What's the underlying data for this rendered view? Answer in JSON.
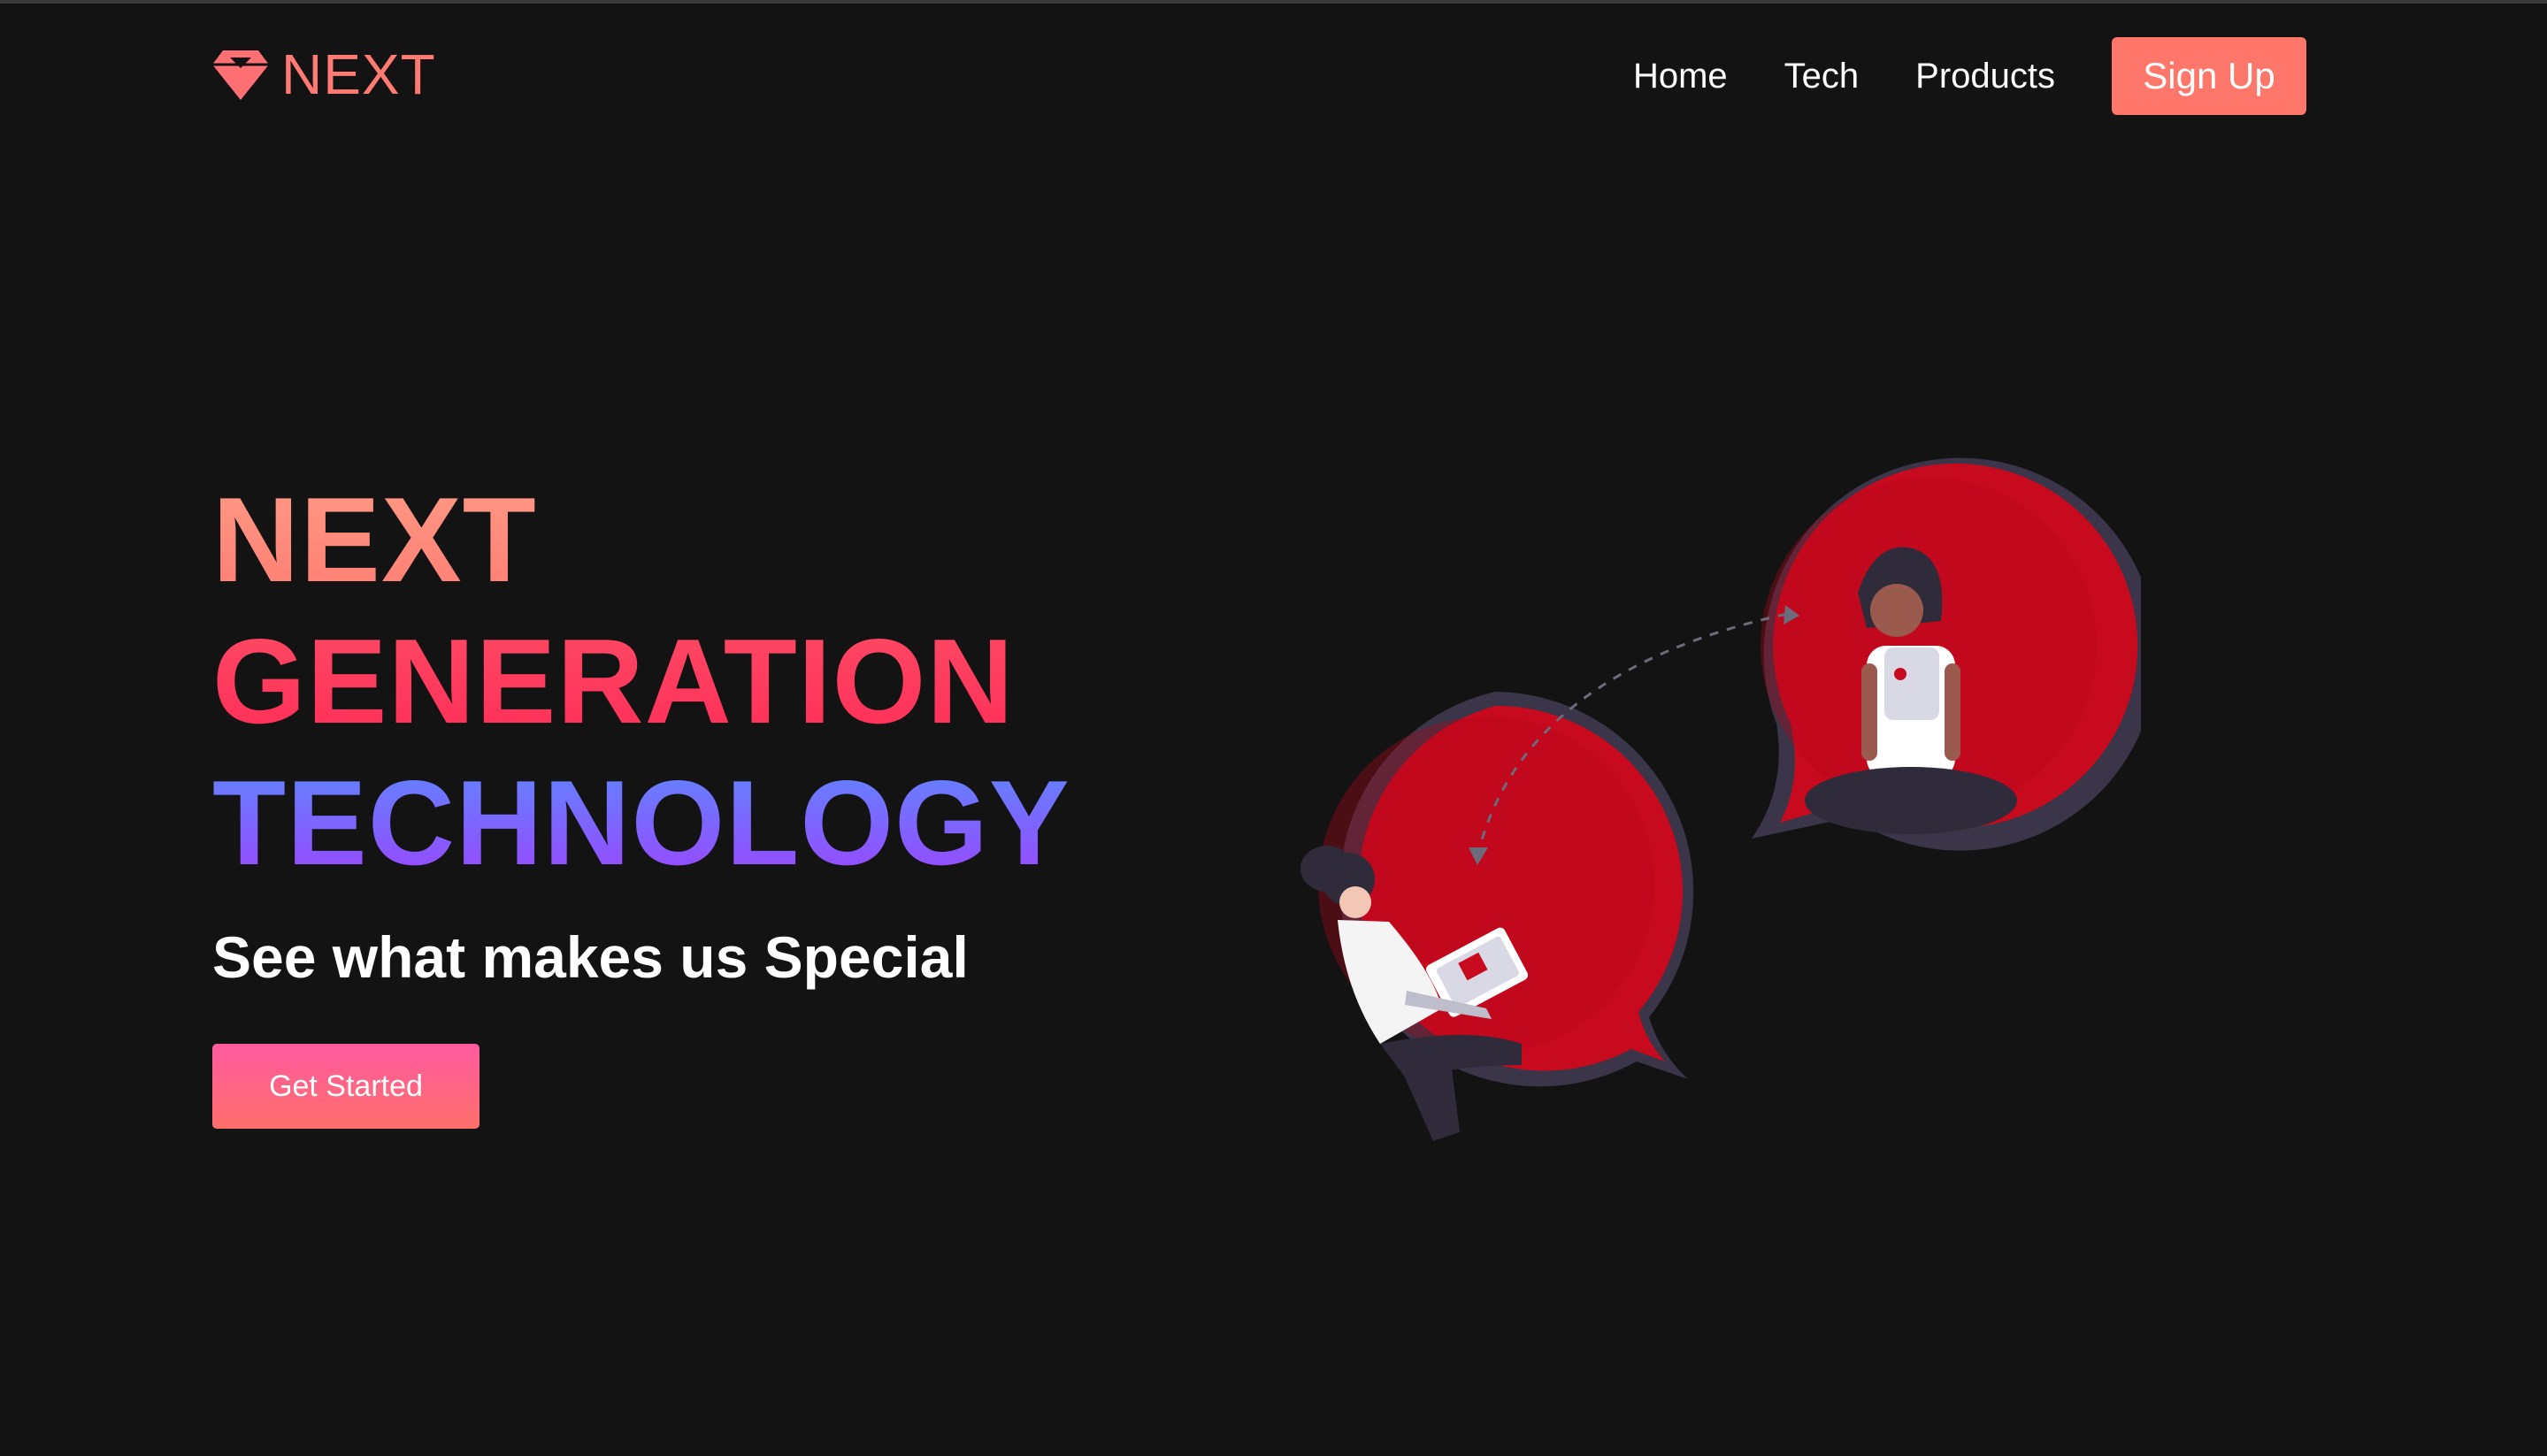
{
  "brand": {
    "name": "NEXT",
    "icon": "gem-icon",
    "color": "#ff7a73"
  },
  "nav": {
    "links": [
      "Home",
      "Tech",
      "Products"
    ],
    "signup_label": "Sign Up",
    "signup_color": "#ff766b"
  },
  "hero": {
    "line1": "NEXT",
    "line2": "GENERATION",
    "line3": "TECHNOLOGY",
    "subtitle": "See what makes us Special",
    "cta_label": "Get Started"
  },
  "illustration": {
    "name": "two-people-chat-bubbles",
    "bubble_color": "#c80a1e",
    "outline_color": "#3a3548"
  },
  "colors": {
    "background": "#131313",
    "line1_gradient": [
      "#ff9b86",
      "#ff7c72"
    ],
    "line2_gradient": [
      "#ff4d66",
      "#ff2b57"
    ],
    "line3_gradient": [
      "#5a8cff",
      "#a040ff"
    ],
    "cta_gradient": [
      "#ff5aa0",
      "#ff6f6a"
    ]
  }
}
